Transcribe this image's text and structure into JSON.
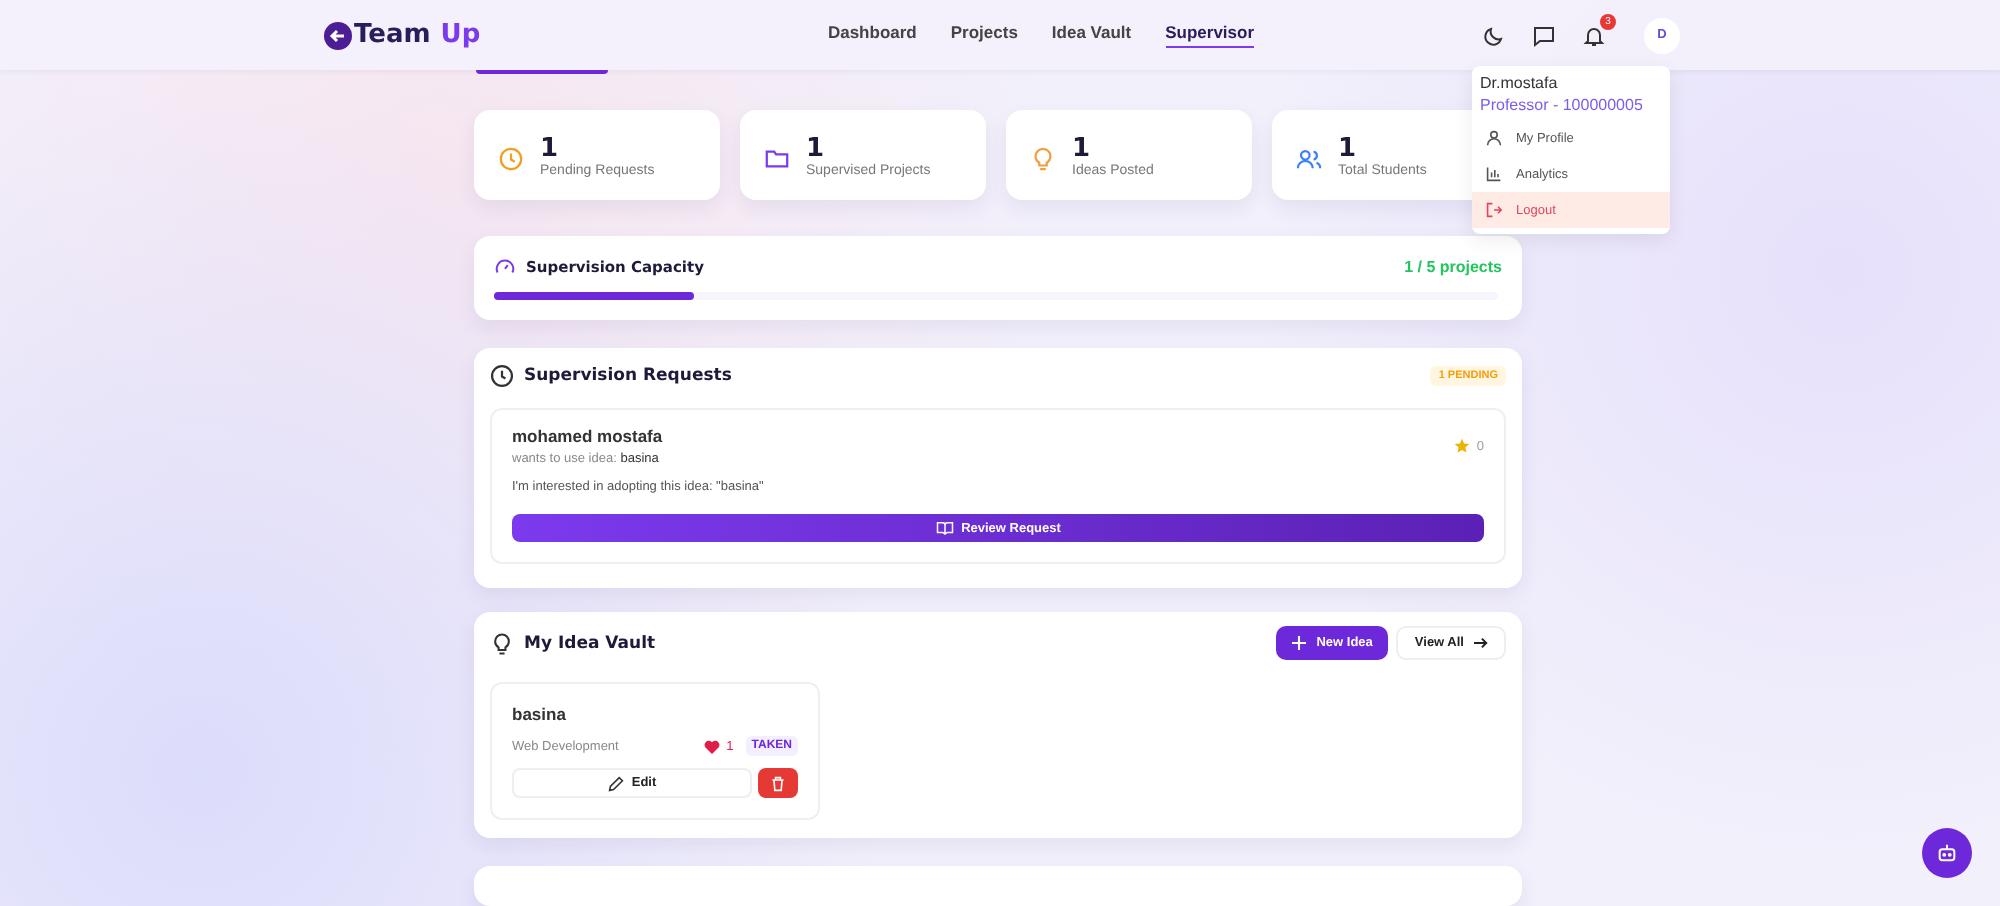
{
  "nav": {
    "logo_first": "Team",
    "logo_second": "Up",
    "links": [
      {
        "label": "Dashboard",
        "selected": false
      },
      {
        "label": "Projects",
        "selected": false
      },
      {
        "label": "Idea Vault",
        "selected": false
      },
      {
        "label": "Supervisor",
        "selected": true
      }
    ],
    "notification_count": "3",
    "avatar": "D"
  },
  "user_menu": {
    "name": "Dr.mostafa",
    "role": "Professor - 100000005",
    "items": [
      {
        "kind": "profile",
        "label": "My Profile",
        "selected": false
      },
      {
        "kind": "analytics",
        "label": "Analytics",
        "selected": false
      },
      {
        "kind": "logout",
        "label": "Logout",
        "selected": true
      }
    ]
  },
  "stats": [
    {
      "kind": "clock",
      "value": "1",
      "label": "Pending Requests"
    },
    {
      "kind": "folder",
      "value": "1",
      "label": "Supervised Projects"
    },
    {
      "kind": "bulb",
      "value": "1",
      "label": "Ideas Posted"
    },
    {
      "kind": "users",
      "value": "1",
      "label": "Total Students"
    }
  ],
  "capacity": {
    "title": "Supervision Capacity",
    "reading": "1 / 5 projects",
    "level": 0.2
  },
  "requests": {
    "title": "Supervision Requests",
    "badge": "1 PENDING",
    "items": [
      {
        "student": "mohamed mostafa",
        "prefix": "wants to use idea:",
        "idea": "basina",
        "message": "I'm interested in adopting this idea: \"basina\"",
        "rating": "0",
        "button": "Review Request"
      }
    ]
  },
  "vault": {
    "title": "My Idea Vault",
    "new_button": "New Idea",
    "view_all": "View All",
    "ideas": [
      {
        "title": "basina",
        "category": "Web Development",
        "likes": "1",
        "status": "TAKEN",
        "edit": "Edit"
      }
    ]
  }
}
